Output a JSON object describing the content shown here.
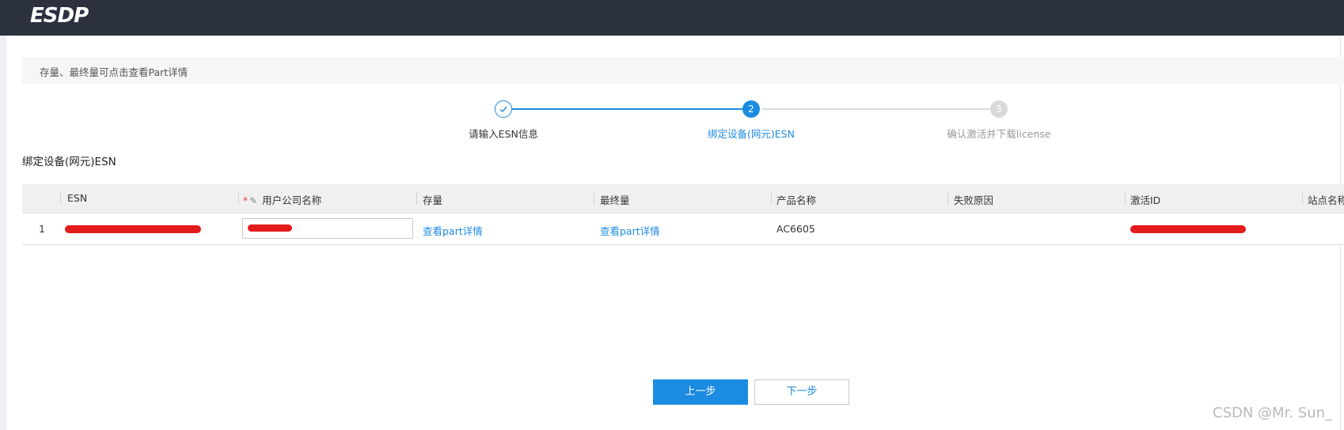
{
  "header": {
    "logo_text": "ESDP"
  },
  "notice": {
    "text": "存量、最终量可点击查看Part详情"
  },
  "steps": [
    {
      "number": "",
      "label": "请输入ESN信息",
      "state": "done"
    },
    {
      "number": "2",
      "label": "绑定设备(网元)ESN",
      "state": "active"
    },
    {
      "number": "3",
      "label": "确认激活并下载license",
      "state": "pending"
    }
  ],
  "section_title": "绑定设备(网元)ESN",
  "table": {
    "columns": [
      "ESN",
      "用户公司名称",
      "存量",
      "最终量",
      "产品名称",
      "失败原因",
      "激活ID",
      "站点名称"
    ],
    "rows": [
      {
        "index": "1",
        "esn": "",
        "company": "",
        "stock": "查看part详情",
        "final": "查看part详情",
        "product": "AC6605",
        "failure_reason": "",
        "activation_id": "",
        "site": ""
      }
    ]
  },
  "buttons": {
    "prev": "上一步",
    "next": "下一步"
  },
  "watermark": "CSDN @Mr. Sun_",
  "colors": {
    "accent": "#1c8be2",
    "topbar": "#2c3140",
    "redaction": "#e31b1b",
    "required": "#e4393c"
  }
}
